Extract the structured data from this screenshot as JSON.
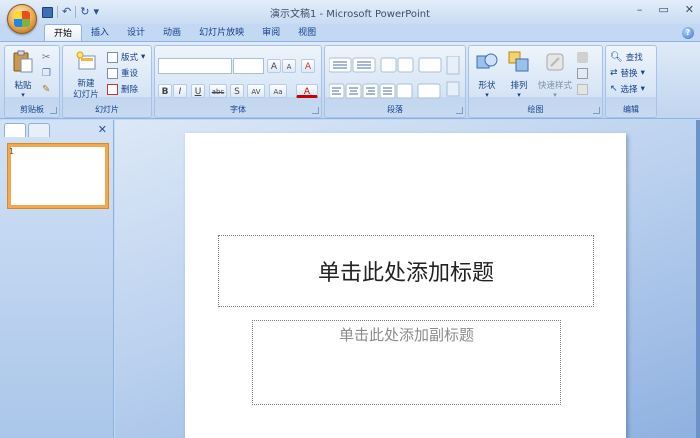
{
  "window": {
    "title": "演示文稿1 - Microsoft PowerPoint",
    "controls": [
      "–",
      "▭",
      "✕"
    ]
  },
  "quick_access": {
    "undo": "↶",
    "redo": "↻",
    "more": "▾"
  },
  "tabs": [
    {
      "label": "开始",
      "active": true
    },
    {
      "label": "插入"
    },
    {
      "label": "设计"
    },
    {
      "label": "动画"
    },
    {
      "label": "幻灯片放映"
    },
    {
      "label": "审阅"
    },
    {
      "label": "视图"
    }
  ],
  "ribbon": {
    "clipboard": {
      "label": "剪贴板",
      "paste": "粘贴",
      "cut_icon": "✂",
      "copy_icon": "❐",
      "painter_icon": "✎"
    },
    "slides": {
      "label": "幻灯片",
      "new_slide": "新建\n幻灯片",
      "layout": "版式",
      "reset": "重设",
      "delete": "删除"
    },
    "font": {
      "label": "字体",
      "font_name": "",
      "font_size": "",
      "bold": "B",
      "italic": "I",
      "underline": "U",
      "strike": "abc",
      "shadow": "S",
      "spacing": "AV",
      "case": "Aa",
      "grow": "A",
      "shrink": "A",
      "clear": "A",
      "color": "A"
    },
    "paragraph": {
      "label": "段落"
    },
    "drawing": {
      "label": "绘图",
      "shapes": "形状",
      "arrange": "排列",
      "quick_styles": "快速样式"
    },
    "editing": {
      "label": "编辑",
      "find": "查找",
      "replace": "替换",
      "select": "选择"
    }
  },
  "slide_pane": {
    "thumb_number": "1",
    "close": "✕"
  },
  "slide": {
    "title_placeholder": "单击此处添加标题",
    "subtitle_placeholder": "单击此处添加副标题"
  },
  "colors": {
    "accent": "#15428b",
    "selected_thumb": "#f2a94b"
  }
}
